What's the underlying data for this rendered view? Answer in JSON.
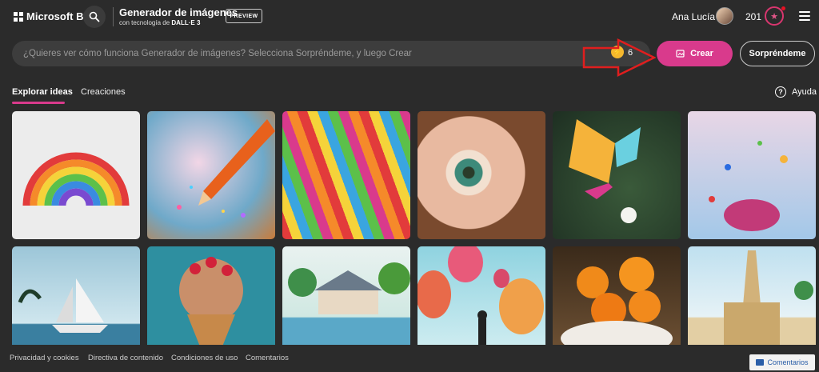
{
  "header": {
    "brand": "Microsoft Bing",
    "title": "Generador de imágenes",
    "subtitle_prefix": "con tecnología de",
    "subtitle_model": "DALL·E 3",
    "preview_badge": "PREVIEW",
    "user_name": "Ana Lucía",
    "rewards_points": "201"
  },
  "prompt": {
    "placeholder": "¿Quieres ver cómo funciona Generador de imágenes? Selecciona Sorpréndeme, y luego Crear",
    "boost_count": "6",
    "create_label": "Crear",
    "surprise_label": "Sorpréndeme"
  },
  "tabs": [
    {
      "label": "Explorar ideas"
    },
    {
      "label": "Creaciones"
    }
  ],
  "help_label": "Ayuda",
  "footer": {
    "links": [
      "Privacidad y cookies",
      "Directiva de contenido",
      "Condiciones de uso",
      "Comentarios"
    ],
    "feedback_button": "Comentarios"
  },
  "colors": {
    "accent": "#d93a8c",
    "background": "#2b2b2b",
    "annotation_arrow": "#e01e1e"
  },
  "icons": [
    "microsoft-logo-icon",
    "search-icon",
    "trophy-icon",
    "menu-icon",
    "boost-icon",
    "create-image-icon",
    "help-icon",
    "feedback-icon"
  ]
}
